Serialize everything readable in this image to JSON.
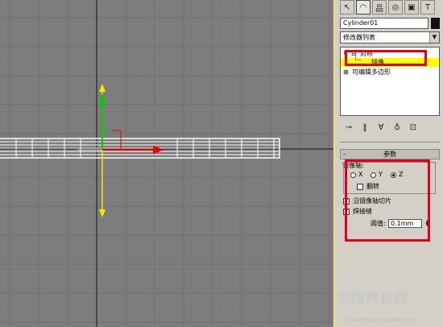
{
  "object_name": "Cylinder01",
  "modifier_list": {
    "label": "修改器列表"
  },
  "stack": {
    "items": [
      {
        "label": "对称"
      },
      {
        "label": "镜像"
      },
      {
        "label": "可编辑多边形"
      }
    ]
  },
  "rollout": {
    "title": "参数",
    "mirror_axis_label": "镜像轴:",
    "axes": [
      {
        "label": "X"
      },
      {
        "label": "Y"
      },
      {
        "label": "Z",
        "selected": true
      }
    ],
    "flip_label": "翻转",
    "slice_label": "沿镜像轴切片",
    "weld_label": "焊接缝",
    "threshold_label": "阈值:",
    "threshold_value": "0.1mm"
  },
  "watermark": {
    "text": "中国教程网",
    "url": "jiaocheng.chazidian.com"
  },
  "colors": {
    "viewport_bg": "#7d7d7d",
    "highlight_red": "#e3001b",
    "selected_row": "#ffff00",
    "gizmo_yellow": "#f3e800",
    "gizmo_green": "#00cc00",
    "gizmo_red": "#ee0000"
  }
}
